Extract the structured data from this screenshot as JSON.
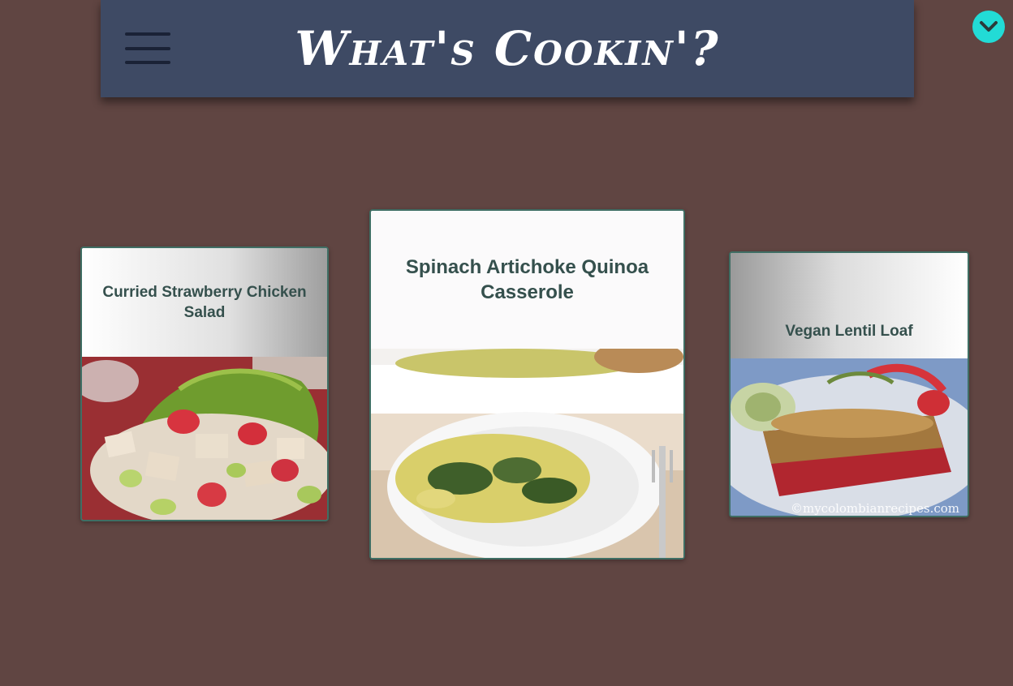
{
  "header": {
    "title": "What's Cookin'?",
    "menu_icon": "hamburger-menu-icon",
    "background": "#3e4a64"
  },
  "scroll_button": {
    "icon": "chevron-down-icon",
    "color": "#22dbd6"
  },
  "recipes": [
    {
      "title": "Curried Strawberry Chicken Salad",
      "image": "strawberry-chicken-salad-photo"
    },
    {
      "title": "Spinach Artichoke Quinoa Casserole",
      "image": "spinach-quinoa-casserole-photo"
    },
    {
      "title": "Vegan Lentil Loaf",
      "image": "lentil-loaf-photo",
      "watermark": "©mycolombianrecipes.com"
    }
  ],
  "colors": {
    "page_background": "#604542",
    "card_title": "#35504d",
    "card_border": "#3f6e64"
  }
}
